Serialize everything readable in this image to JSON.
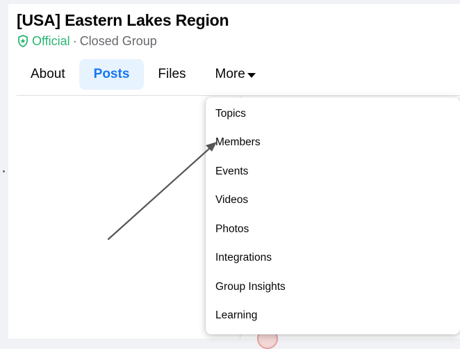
{
  "group": {
    "title": "[USA] Eastern Lakes Region",
    "official_label": "Official",
    "separator": "·",
    "privacy": "Closed Group"
  },
  "tabs": [
    {
      "label": "About",
      "active": false
    },
    {
      "label": "Posts",
      "active": true
    },
    {
      "label": "Files",
      "active": false
    },
    {
      "label": "More",
      "active": false
    }
  ],
  "dropdown": {
    "items": [
      {
        "label": "Topics"
      },
      {
        "label": "Members"
      },
      {
        "label": "Events"
      },
      {
        "label": "Videos"
      },
      {
        "label": "Photos"
      },
      {
        "label": "Integrations"
      },
      {
        "label": "Group Insights"
      },
      {
        "label": "Learning"
      }
    ]
  },
  "colors": {
    "accent": "#1877f2",
    "active_tab_bg": "#e7f3ff",
    "official_green": "#2bb673",
    "secondary_text": "#65676b",
    "annotation_arrow": "#555555"
  },
  "icons": {
    "official_badge": "shield-icon",
    "more_caret": "caret-down-icon",
    "annotation": "arrow-annotation"
  }
}
